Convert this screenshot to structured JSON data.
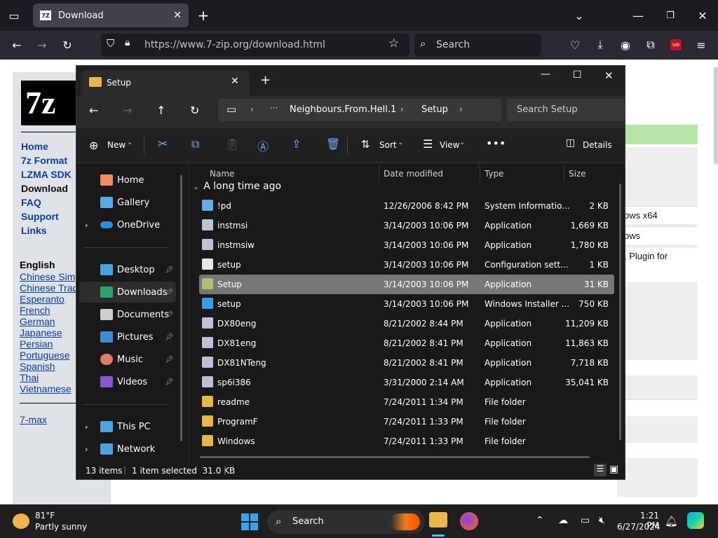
{
  "browser": {
    "tab_title": "Download",
    "tab_favicon": "7Z",
    "url": "https://www.7-zip.org/download.html",
    "search_placeholder": "Search"
  },
  "website": {
    "logo_text": "7z",
    "nav": [
      "Home",
      "7z Format",
      "LZMA SDK",
      "Download",
      "FAQ",
      "Support",
      "Links"
    ],
    "lang_heading": "English",
    "languages": [
      "Chinese Simp",
      "Chinese Trad",
      "Esperanto",
      "French",
      "German",
      "Japanese",
      "Persian",
      "Portuguese",
      "Spanish",
      "Thai",
      "Vietnamese"
    ],
    "more_link": "7-max",
    "right_snippets": [
      "ows x64",
      "ows",
      ", Plugin for"
    ]
  },
  "explorer": {
    "tab_title": "Setup",
    "breadcrumb": [
      "Neighbours.From.Hell.1",
      "Setup"
    ],
    "search_placeholder": "Search Setup",
    "commands": {
      "new": "New",
      "sort": "Sort",
      "view": "View",
      "details": "Details"
    },
    "sidebar": {
      "top": [
        "Home",
        "Gallery",
        "OneDrive"
      ],
      "pinned": [
        "Desktop",
        "Downloads",
        "Documents",
        "Pictures",
        "Music",
        "Videos"
      ],
      "bottom": [
        "This PC",
        "Network"
      ]
    },
    "columns": [
      "Name",
      "Date modified",
      "Type",
      "Size"
    ],
    "group_label": "A long time ago",
    "files": [
      {
        "name": "!pd",
        "date": "12/26/2006 8:42 PM",
        "type": "System Informatio...",
        "size": "2 KB",
        "icon": "sysinfo-icon"
      },
      {
        "name": "instmsi",
        "date": "3/14/2003 10:06 PM",
        "type": "Application",
        "size": "1,669 KB",
        "icon": "app-icon"
      },
      {
        "name": "instmsiw",
        "date": "3/14/2003 10:06 PM",
        "type": "Application",
        "size": "1,780 KB",
        "icon": "app-icon"
      },
      {
        "name": "setup",
        "date": "3/14/2003 10:06 PM",
        "type": "Configuration sett...",
        "size": "1 KB",
        "icon": "config-icon"
      },
      {
        "name": "Setup",
        "date": "3/14/2003 10:06 PM",
        "type": "Application",
        "size": "31 KB",
        "icon": "setup-app-icon"
      },
      {
        "name": "setup",
        "date": "3/14/2003 10:06 PM",
        "type": "Windows Installer ...",
        "size": "750 KB",
        "icon": "installer-icon"
      },
      {
        "name": "DX80eng",
        "date": "8/21/2002 8:44 PM",
        "type": "Application",
        "size": "11,209 KB",
        "icon": "app-icon"
      },
      {
        "name": "DX81eng",
        "date": "8/21/2002 8:41 PM",
        "type": "Application",
        "size": "11,863 KB",
        "icon": "app-icon"
      },
      {
        "name": "DX81NTeng",
        "date": "8/21/2002 8:41 PM",
        "type": "Application",
        "size": "7,718 KB",
        "icon": "app-icon"
      },
      {
        "name": "sp6i386",
        "date": "3/31/2000 2:14 AM",
        "type": "Application",
        "size": "35,041 KB",
        "icon": "app-icon"
      },
      {
        "name": "readme",
        "date": "7/24/2011 1:34 PM",
        "type": "File folder",
        "size": "",
        "icon": "folder-icon"
      },
      {
        "name": "ProgramF",
        "date": "7/24/2011 1:33 PM",
        "type": "File folder",
        "size": "",
        "icon": "folder-icon"
      },
      {
        "name": "Windows",
        "date": "7/24/2011 1:33 PM",
        "type": "File folder",
        "size": "",
        "icon": "folder-icon"
      }
    ],
    "selected_index": 4,
    "status": {
      "count": "13 items",
      "selection": "1 item selected  31.0 KB"
    }
  },
  "taskbar": {
    "weather_temp": "81°F",
    "weather_desc": "Partly sunny",
    "search_placeholder": "Search",
    "time": "1:21 PM",
    "date": "6/27/2024"
  },
  "colors": {
    "accent": "#0067c0",
    "folder": "#e8b64a",
    "selected_row": "#777777",
    "web_link": "#0b3f9e"
  }
}
